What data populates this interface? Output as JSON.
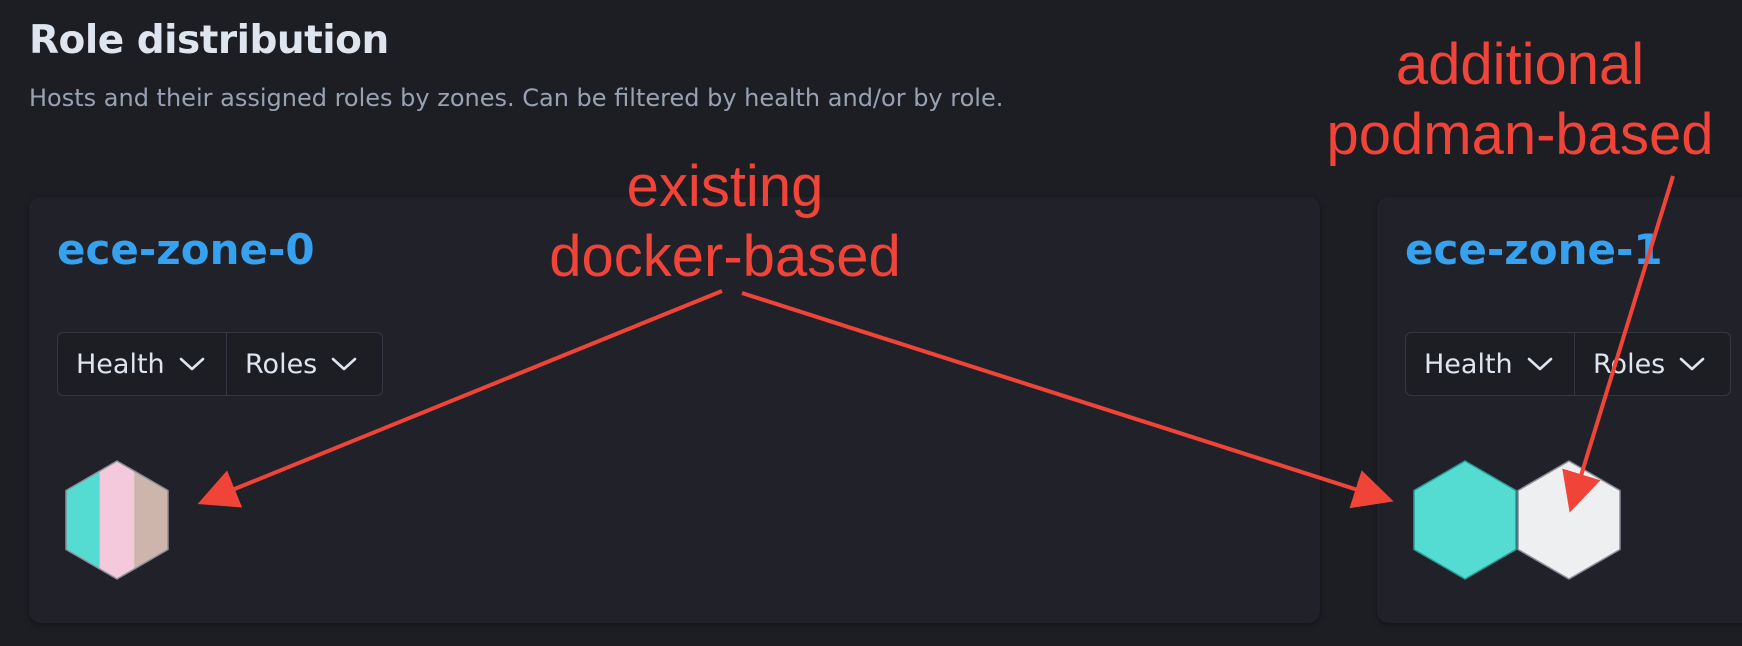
{
  "header": {
    "title": "Role distribution",
    "subtitle": "Hosts and their assigned roles by zones. Can be filtered by health and/or by role."
  },
  "zones": [
    {
      "name": "ece-zone-0",
      "filters": {
        "health_label": "Health",
        "roles_label": "Roles"
      },
      "hosts": [
        {
          "roles_colors": [
            "#54dcd3",
            "#f4c9dc",
            "#cdb5ac"
          ]
        }
      ]
    },
    {
      "name": "ece-zone-1",
      "filters": {
        "health_label": "Health",
        "roles_label": "Roles"
      },
      "hosts": [
        {
          "roles_colors": [
            "#54dcd3"
          ]
        },
        {
          "roles_colors": [
            "#eeeff1"
          ]
        }
      ]
    }
  ],
  "annotations": {
    "existing_line1": "existing",
    "existing_line2": "docker-based",
    "additional_line1": "additional",
    "additional_line2": "podman-based",
    "color": "#f04438"
  },
  "icons": {
    "filter_chevron": "chevron-down-icon",
    "host": "hexagon-icon"
  }
}
